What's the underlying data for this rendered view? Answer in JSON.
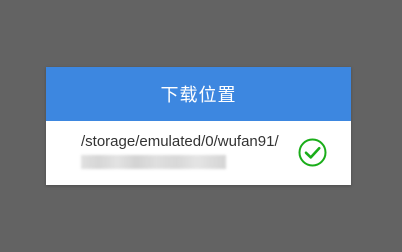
{
  "dialog": {
    "title": "下载位置",
    "option": {
      "path": "/storage/emulated/0/wufan91/",
      "selected": true,
      "check_icon": "check-circle-icon"
    }
  },
  "colors": {
    "overlay": "#636363",
    "header": "#3d87e0",
    "header_text": "#ffffff",
    "check": "#1aad19"
  }
}
